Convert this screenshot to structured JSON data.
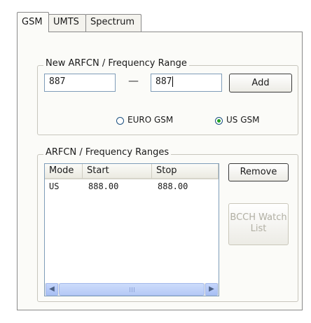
{
  "tabs": [
    {
      "label": "GSM",
      "active": true
    },
    {
      "label": "UMTS",
      "active": false
    },
    {
      "label": "Spectrum",
      "active": false
    }
  ],
  "new_range": {
    "legend": "New ARFCN / Frequency Range",
    "start_value": "887",
    "separator": "—",
    "stop_value": "887",
    "add_label": "Add",
    "radios": [
      {
        "label": "EURO GSM",
        "checked": false
      },
      {
        "label": "US GSM",
        "checked": true
      }
    ]
  },
  "ranges": {
    "legend": "ARFCN / Frequency Ranges",
    "columns": [
      "Mode",
      "Start",
      "Stop"
    ],
    "rows": [
      {
        "mode": "US",
        "start": "888.00",
        "stop": "888.00"
      }
    ],
    "remove_label": "Remove",
    "bcch_label_line1": "BCCH Watch",
    "bcch_label_line2": "List"
  },
  "scrollbar": {
    "left_glyph": "◀",
    "right_glyph": "▶"
  },
  "colors": {
    "accent": "#21a121",
    "border": "#7f9db9"
  }
}
